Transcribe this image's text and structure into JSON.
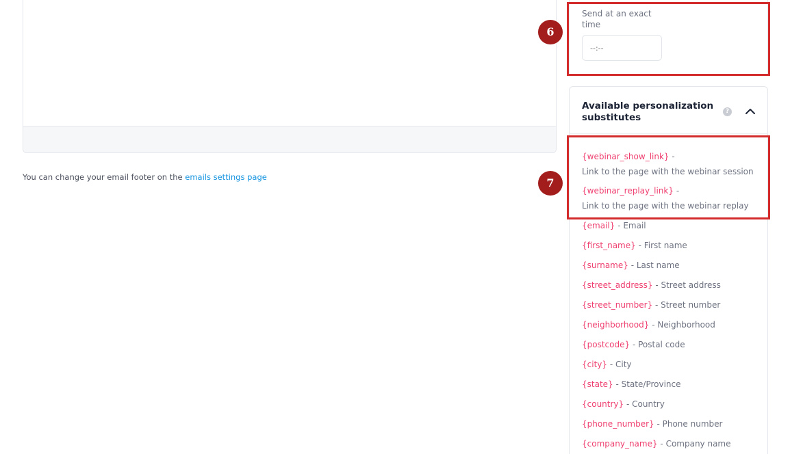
{
  "footer_note": {
    "text": "You can change your email footer on the ",
    "link": "emails settings page"
  },
  "schedule": {
    "label": "Send at an exact time",
    "time_placeholder": "--:--"
  },
  "personalization": {
    "title": "Available personalization substitutes",
    "help_icon": "?",
    "items": [
      {
        "code": "{webinar_show_link}",
        "desc": " -",
        "desc2": "Link to the page with the webinar session"
      },
      {
        "code": "{webinar_replay_link}",
        "desc": " -",
        "desc2": "Link to the page with the webinar replay"
      },
      {
        "code": "{email}",
        "desc": " - Email"
      },
      {
        "code": "{first_name}",
        "desc": " - First name"
      },
      {
        "code": "{surname}",
        "desc": " - Last name"
      },
      {
        "code": "{street_address}",
        "desc": " - Street address"
      },
      {
        "code": "{street_number}",
        "desc": " - Street number"
      },
      {
        "code": "{neighborhood}",
        "desc": " - Neighborhood"
      },
      {
        "code": "{postcode}",
        "desc": " - Postal code"
      },
      {
        "code": "{city}",
        "desc": " - City"
      },
      {
        "code": "{state}",
        "desc": " - State/Province"
      },
      {
        "code": "{country}",
        "desc": " - Country"
      },
      {
        "code": "{phone_number}",
        "desc": " - Phone number"
      },
      {
        "code": "{company_name}",
        "desc": " - Company name"
      }
    ]
  },
  "annotations": {
    "badge_6": "6",
    "badge_7": "7",
    "colors": {
      "highlight": "#d32b2b",
      "badge": "#a31d1d",
      "accent_link": "#1594e0",
      "code": "#ef3f6f"
    }
  }
}
